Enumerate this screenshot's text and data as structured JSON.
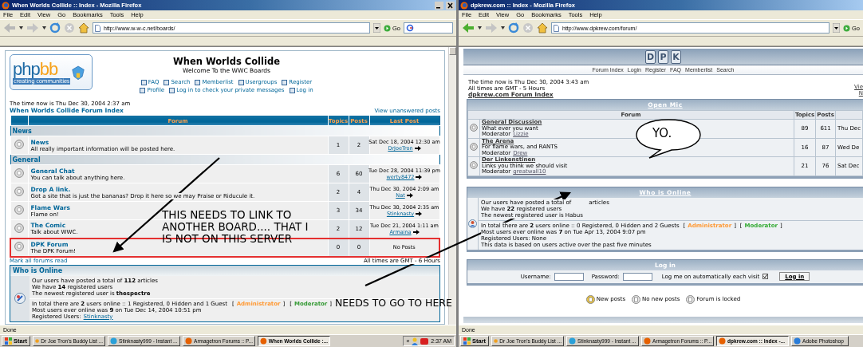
{
  "left_window": {
    "title": "When Worlds Collide :: Index - Mozilla Firefox",
    "window_controls": true,
    "menu": [
      "File",
      "Edit",
      "View",
      "Go",
      "Bookmarks",
      "Tools",
      "Help"
    ],
    "address": "http://www.w-w-c.net/boards/",
    "go": "Go",
    "search_box": true,
    "page": {
      "logo": {
        "parts": [
          "php",
          "bb"
        ],
        "tagline": "creating communities"
      },
      "site_title": "When Worlds Collide",
      "subtitle": "Welcome To the WWC Boards",
      "nav": [
        [
          "FAQ",
          "Search",
          "Memberlist",
          "Usergroups",
          "Register"
        ],
        [
          "Profile",
          "Log in to check your private messages",
          "Log in"
        ]
      ],
      "time": "The time now is Thu Dec 30, 2004 2:37 am",
      "index_link": "When Worlds Collide Forum Index",
      "unanswered": "View unanswered posts",
      "table": {
        "columns": [
          "Forum",
          "Topics",
          "Posts",
          "Last Post"
        ],
        "categories": [
          {
            "name": "News",
            "forums": [
              {
                "name": "News",
                "description": "All really important information will be posted here.",
                "topics": "1",
                "posts": "2",
                "last_post": "Sat Dec 18, 2004 12:30 am",
                "last_user": "DrJoeTron",
                "highlighted": false
              }
            ]
          },
          {
            "name": "General",
            "forums": [
              {
                "name": "General Chat",
                "description": "You can talk about anything here.",
                "topics": "6",
                "posts": "60",
                "last_post": "Tue Dec 28, 2004 11:39 pm",
                "last_user": "werty8472",
                "highlighted": false
              },
              {
                "name": "Drop A link.",
                "description": "Got a site that is just the bananas? Drop it here so we may Praise or Riducule it.",
                "topics": "2",
                "posts": "4",
                "last_post": "Thu Dec 30, 2004 2:09 am",
                "last_user": "Nat",
                "highlighted": false
              },
              {
                "name": "Flame Wars",
                "description": "Flame on!",
                "topics": "3",
                "posts": "34",
                "last_post": "Thu Dec 30, 2004 2:35 am",
                "last_user": "Stinknasty",
                "highlighted": false
              },
              {
                "name": "The Comic",
                "description": "Talk about WWC.",
                "topics": "2",
                "posts": "12",
                "last_post": "Tue Dec 21, 2004 1:11 am",
                "last_user": "Armaina",
                "highlighted": false
              },
              {
                "name": "DPK Forum",
                "description": "The DPK Forum!",
                "topics": "0",
                "posts": "0",
                "last_post": "No Posts",
                "highlighted": true
              }
            ]
          }
        ]
      },
      "mark_read": "Mark all forums read",
      "timezone": "All times are GMT - 6 Hours",
      "online": {
        "title": "Who is Online",
        "stats": [
          "Our users have posted a total of **112** articles",
          "We have **14** registered users",
          "The newest registered user is **thespectre**"
        ],
        "online_line": "In total there are **2** users online :: 1 Registered, 0 Hidden and 1 Guest",
        "legend": [
          {
            "open": "[",
            "label": "Administrator",
            "close": "]",
            "color": "#ff9933"
          },
          {
            "open": "[",
            "label": "Moderator",
            "close": "]",
            "color": "#339933"
          }
        ],
        "record": "Most users ever online was **9** on Tue Dec 14, 2004 10:51 pm",
        "registered_label": "Registered Users:",
        "registered_users": [
          "Stinknasty"
        ]
      }
    },
    "status": "Done",
    "taskbar": {
      "start": "Start",
      "tasks": [
        {
          "label": "Dr Joe Tron's Buddy List ...",
          "selected": false
        },
        {
          "label": "Stinknasty999 - Instant ...",
          "selected": false
        },
        {
          "label": "Armagetron Forums :: P...",
          "selected": false
        },
        {
          "label": "When Worlds Collide :...",
          "selected": true
        }
      ],
      "tray_chevron": "«",
      "clock": "2:37 AM"
    }
  },
  "right_window": {
    "title": "dpkrew.com :: Index - Mozilla Firefox",
    "window_controls": false,
    "menu": [
      "File",
      "Edit",
      "View",
      "Go",
      "Bookmarks",
      "Tools",
      "Help"
    ],
    "address": "http://www.dpkrew.com/forum/",
    "go": "Go",
    "search_box": false,
    "page": {
      "logo_letters": [
        "D",
        "P",
        "K"
      ],
      "nav": [
        "Forum Index",
        "Login",
        "Register",
        "FAQ",
        "Memberlist",
        "Search"
      ],
      "time": "The time now is Thu Dec 30, 2004 3:43 am",
      "timezone": "All times are GMT - 5 Hours",
      "index_link": "dpkrew.com Forum Index",
      "side_links": [
        "Vie",
        "N"
      ],
      "table": {
        "title": "Open Mic",
        "columns": [
          "Forum",
          "Topics",
          "Posts"
        ],
        "forums": [
          {
            "name": "General Discussion",
            "description": "What ever you want",
            "moderator_label": "Moderator",
            "moderator": "Lizzie",
            "topics": "89",
            "posts": "611",
            "last_post": "Thu Dec"
          },
          {
            "name": "The Arena",
            "description": "For flame wars, and RANTS",
            "moderator_label": "Moderator",
            "moderator": "Drew",
            "topics": "16",
            "posts": "87",
            "last_post": "Wed De"
          },
          {
            "name": "Der Linkenstinen",
            "description": "Links you think we should visit",
            "moderator_label": "Moderator",
            "moderator": "greatwall10",
            "topics": "21",
            "posts": "76",
            "last_post": "Sat Dec"
          }
        ]
      },
      "online": {
        "title": "Who is Online",
        "articles_line": [
          "Our users have posted a total of",
          "articles"
        ],
        "stats": [
          "We have **22** registered users",
          "The newest registered user is Habus"
        ],
        "online_line": "In total there are **2** users online :: 0 Registered, 0 Hidden and 2 Guests",
        "legend": [
          {
            "open": "[",
            "label": "Administrator",
            "close": "]",
            "color": "#ff9933"
          },
          {
            "open": "[",
            "label": "Moderator",
            "close": "]",
            "color": "#33aa33"
          }
        ],
        "extra": [
          "Most users ever online was **7** on Tue Apr 13, 2004 9:07 pm",
          "Registered Users: None",
          "This data is based on users active over the past five minutes"
        ]
      },
      "login": {
        "title": "Log in",
        "username_label": "Username:",
        "password_label": "Password:",
        "autologin_label": "Log me on automatically each visit",
        "autologin_checked": true,
        "button": "Log in"
      },
      "legend": [
        "New posts",
        "No new posts",
        "Forum is locked"
      ]
    },
    "status": "Done",
    "taskbar": {
      "start": "Start",
      "tasks": [
        {
          "label": "Dr Joe Tron's Buddy List ...",
          "selected": false
        },
        {
          "label": "Stinknasty999 - Instant ...",
          "selected": false
        },
        {
          "label": "Armagetron Forums :: P...",
          "selected": false
        },
        {
          "label": "dpkrew.com :: Index -...",
          "selected": true
        },
        {
          "label": "Adobe Photoshop",
          "selected": false
        }
      ]
    }
  },
  "annotations": {
    "notes": [
      "THIS NEEDS TO LINK TO ANOTHER BOARD.... THAT I IS NOT ON THIS SERVER",
      "NEEDS TO GO TO HERE"
    ],
    "bubble": "YO."
  }
}
